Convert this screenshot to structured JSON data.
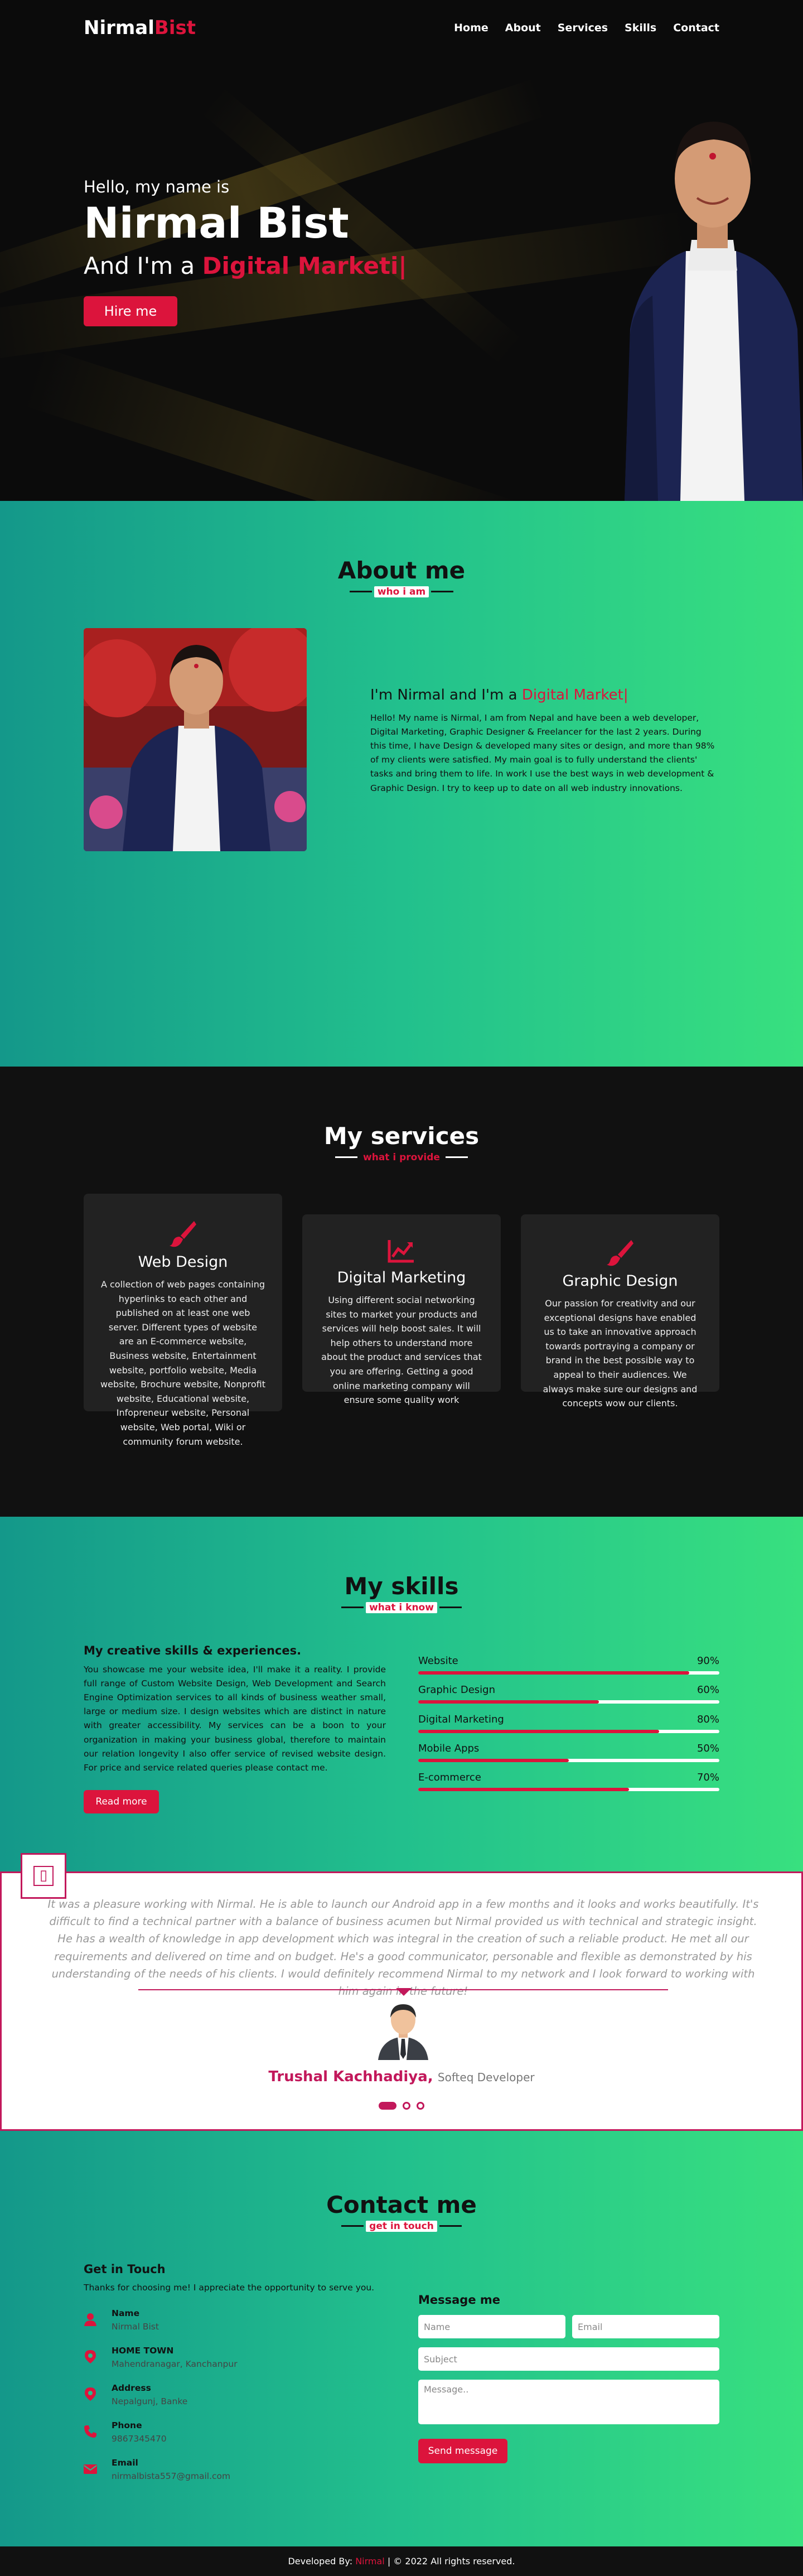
{
  "nav": {
    "logo_main": "Nirmal",
    "logo_accent": "Bist",
    "items": [
      "Home",
      "About",
      "Services",
      "Skills",
      "Contact"
    ]
  },
  "hero": {
    "hello": "Hello, my name is",
    "name": "Nirmal Bist",
    "role_prefix": "And I'm a",
    "role_typed": "Digital Marketi|",
    "button": "Hire me"
  },
  "about": {
    "title": "About me",
    "subtitle": "who i am",
    "heading_prefix": "I'm Nirmal and I'm a",
    "heading_typed": "Digital Market|",
    "text": "Hello! My name is Nirmal, I am from Nepal and have been a web developer, Digital Marketing, Graphic Designer & Freelancer for the last 2 years. During this time, I have Design & developed many sites or design, and more than 98% of my clients were satisfied. My main goal is to fully understand the clients' tasks and bring them to life. In work I use the best ways in web development & Graphic Design. I try to keep up to date on all web industry innovations."
  },
  "services": {
    "title": "My services",
    "subtitle": "what i provide",
    "cards": [
      {
        "icon": "paint-brush-icon",
        "title": "Web Design",
        "text": "A collection of web pages containing hyperlinks to each other and published on at least one web server. Different types of website are an E-commerce website, Business website, Entertainment website, portfolio website, Media website, Brochure website, Nonprofit website, Educational website, Infopreneur website, Personal website, Web portal, Wiki or community forum website."
      },
      {
        "icon": "chart-line-icon",
        "title": "Digital Marketing",
        "text": "Using different social networking sites to market your products and services will help boost sales. It will help others to understand more about the product and services that you are offering. Getting a good online marketing company will ensure some quality work"
      },
      {
        "icon": "paint-brush-icon",
        "title": "Graphic Design",
        "text": "Our passion for creativity and our exceptional designs have enabled us to take an innovative approach towards portraying a company or brand in the best possible way to appeal to their audiences. We always make sure our designs and concepts wow our clients."
      }
    ]
  },
  "skills": {
    "title": "My skills",
    "subtitle": "what i know",
    "heading": "My creative skills & experiences.",
    "text": "You showcase me your website idea, I'll make it a reality. I provide full range of Custom Website Design, Web Development and Search Engine Optimization services to all kinds of business weather small, large or medium size. I design websites which are distinct in nature with greater accessibility. My services can be a boon to your organization in making your business global, therefore to maintain our relation longevity I also offer service of revised website design. For price and service related queries please contact me.",
    "button": "Read more",
    "items": [
      {
        "label": "Website",
        "percent": "90%",
        "value": 90
      },
      {
        "label": "Graphic Design",
        "percent": "60%",
        "value": 60
      },
      {
        "label": "Digital Marketing",
        "percent": "80%",
        "value": 80
      },
      {
        "label": "Mobile Apps",
        "percent": "50%",
        "value": 50
      },
      {
        "label": "E-commerce",
        "percent": "70%",
        "value": 70
      }
    ]
  },
  "testimonial": {
    "quote": "It was a pleasure working with Nirmal. He is able to launch our Android app in a few months and it looks and works beautifully. It's difficult to find a technical partner with a balance of business acumen but Nirmal provided us with technical and strategic insight. He has a wealth of knowledge in app development which was integral in the creation of such a reliable product. He met all our requirements and delivered on time and on budget. He's a good communicator, personable and flexible as demonstrated by his understanding of the needs of his clients. I would definitely recommend Nirmal to my network and I look forward to working with him again in the future!",
    "name": "Trushal Kachhadiya,",
    "role": "Softeq Developer",
    "icon_glyph": "▯"
  },
  "contact": {
    "title": "Contact me",
    "subtitle": "get in touch",
    "left_heading": "Get in Touch",
    "left_text": "Thanks for choosing me! I appreciate the opportunity to serve you.",
    "info": [
      {
        "icon": "user-icon",
        "title": "Name",
        "value": "Nirmal Bist"
      },
      {
        "icon": "location-pin-icon",
        "title": "HOME TOWN",
        "value": "Mahendranagar, Kanchanpur"
      },
      {
        "icon": "location-pin-icon",
        "title": "Address",
        "value": "Nepalgunj, Banke"
      },
      {
        "icon": "phone-icon",
        "title": "Phone",
        "value": "9867345470"
      },
      {
        "icon": "envelope-icon",
        "title": "Email",
        "value": "nirmalbista557@gmail.com"
      }
    ],
    "form_heading": "Message me",
    "name_placeholder": "Name",
    "email_placeholder": "Email",
    "subject_placeholder": "Subject",
    "message_placeholder": "Message..",
    "button": "Send message"
  },
  "footer": {
    "prefix": "Developed By:",
    "author": "Nirmal",
    "suffix": "| © 2022 All rights reserved."
  },
  "colors": {
    "accent": "#dc143c",
    "testimonial_accent": "#c2185b",
    "gradient_start": "#14988a",
    "gradient_end": "#38e07f",
    "dark": "#111111"
  }
}
